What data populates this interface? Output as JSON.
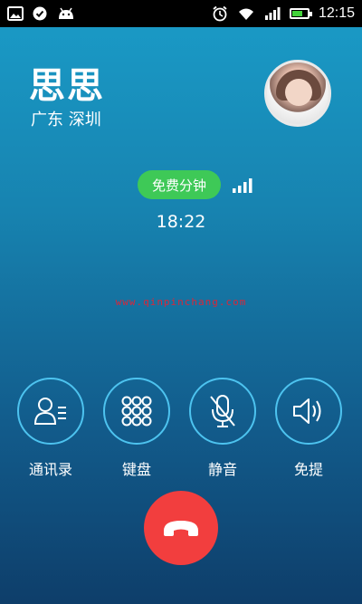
{
  "status_bar": {
    "time": "12:15",
    "left_icons": [
      "image-icon",
      "check-circle-icon",
      "android-icon"
    ],
    "right_icons": [
      "alarm-icon",
      "wifi-icon",
      "signal-icon",
      "battery-icon"
    ],
    "battery_level": 0.6
  },
  "caller": {
    "name": "思思",
    "location": "广东 深圳"
  },
  "call": {
    "free_minutes_label": "免费分钟",
    "signal_strength": 4,
    "duration": "18:22"
  },
  "watermark": "www.qinpinchang.com",
  "controls": [
    {
      "label": "通讯录",
      "icon": "contacts-icon"
    },
    {
      "label": "键盘",
      "icon": "keypad-icon"
    },
    {
      "label": "静音",
      "icon": "mute-icon"
    },
    {
      "label": "免提",
      "icon": "speaker-icon"
    }
  ],
  "colors": {
    "accent_ring": "#4dc3ef",
    "free_pill": "#3ec957",
    "hangup": "#f23e3e",
    "watermark": "#d8273a"
  }
}
